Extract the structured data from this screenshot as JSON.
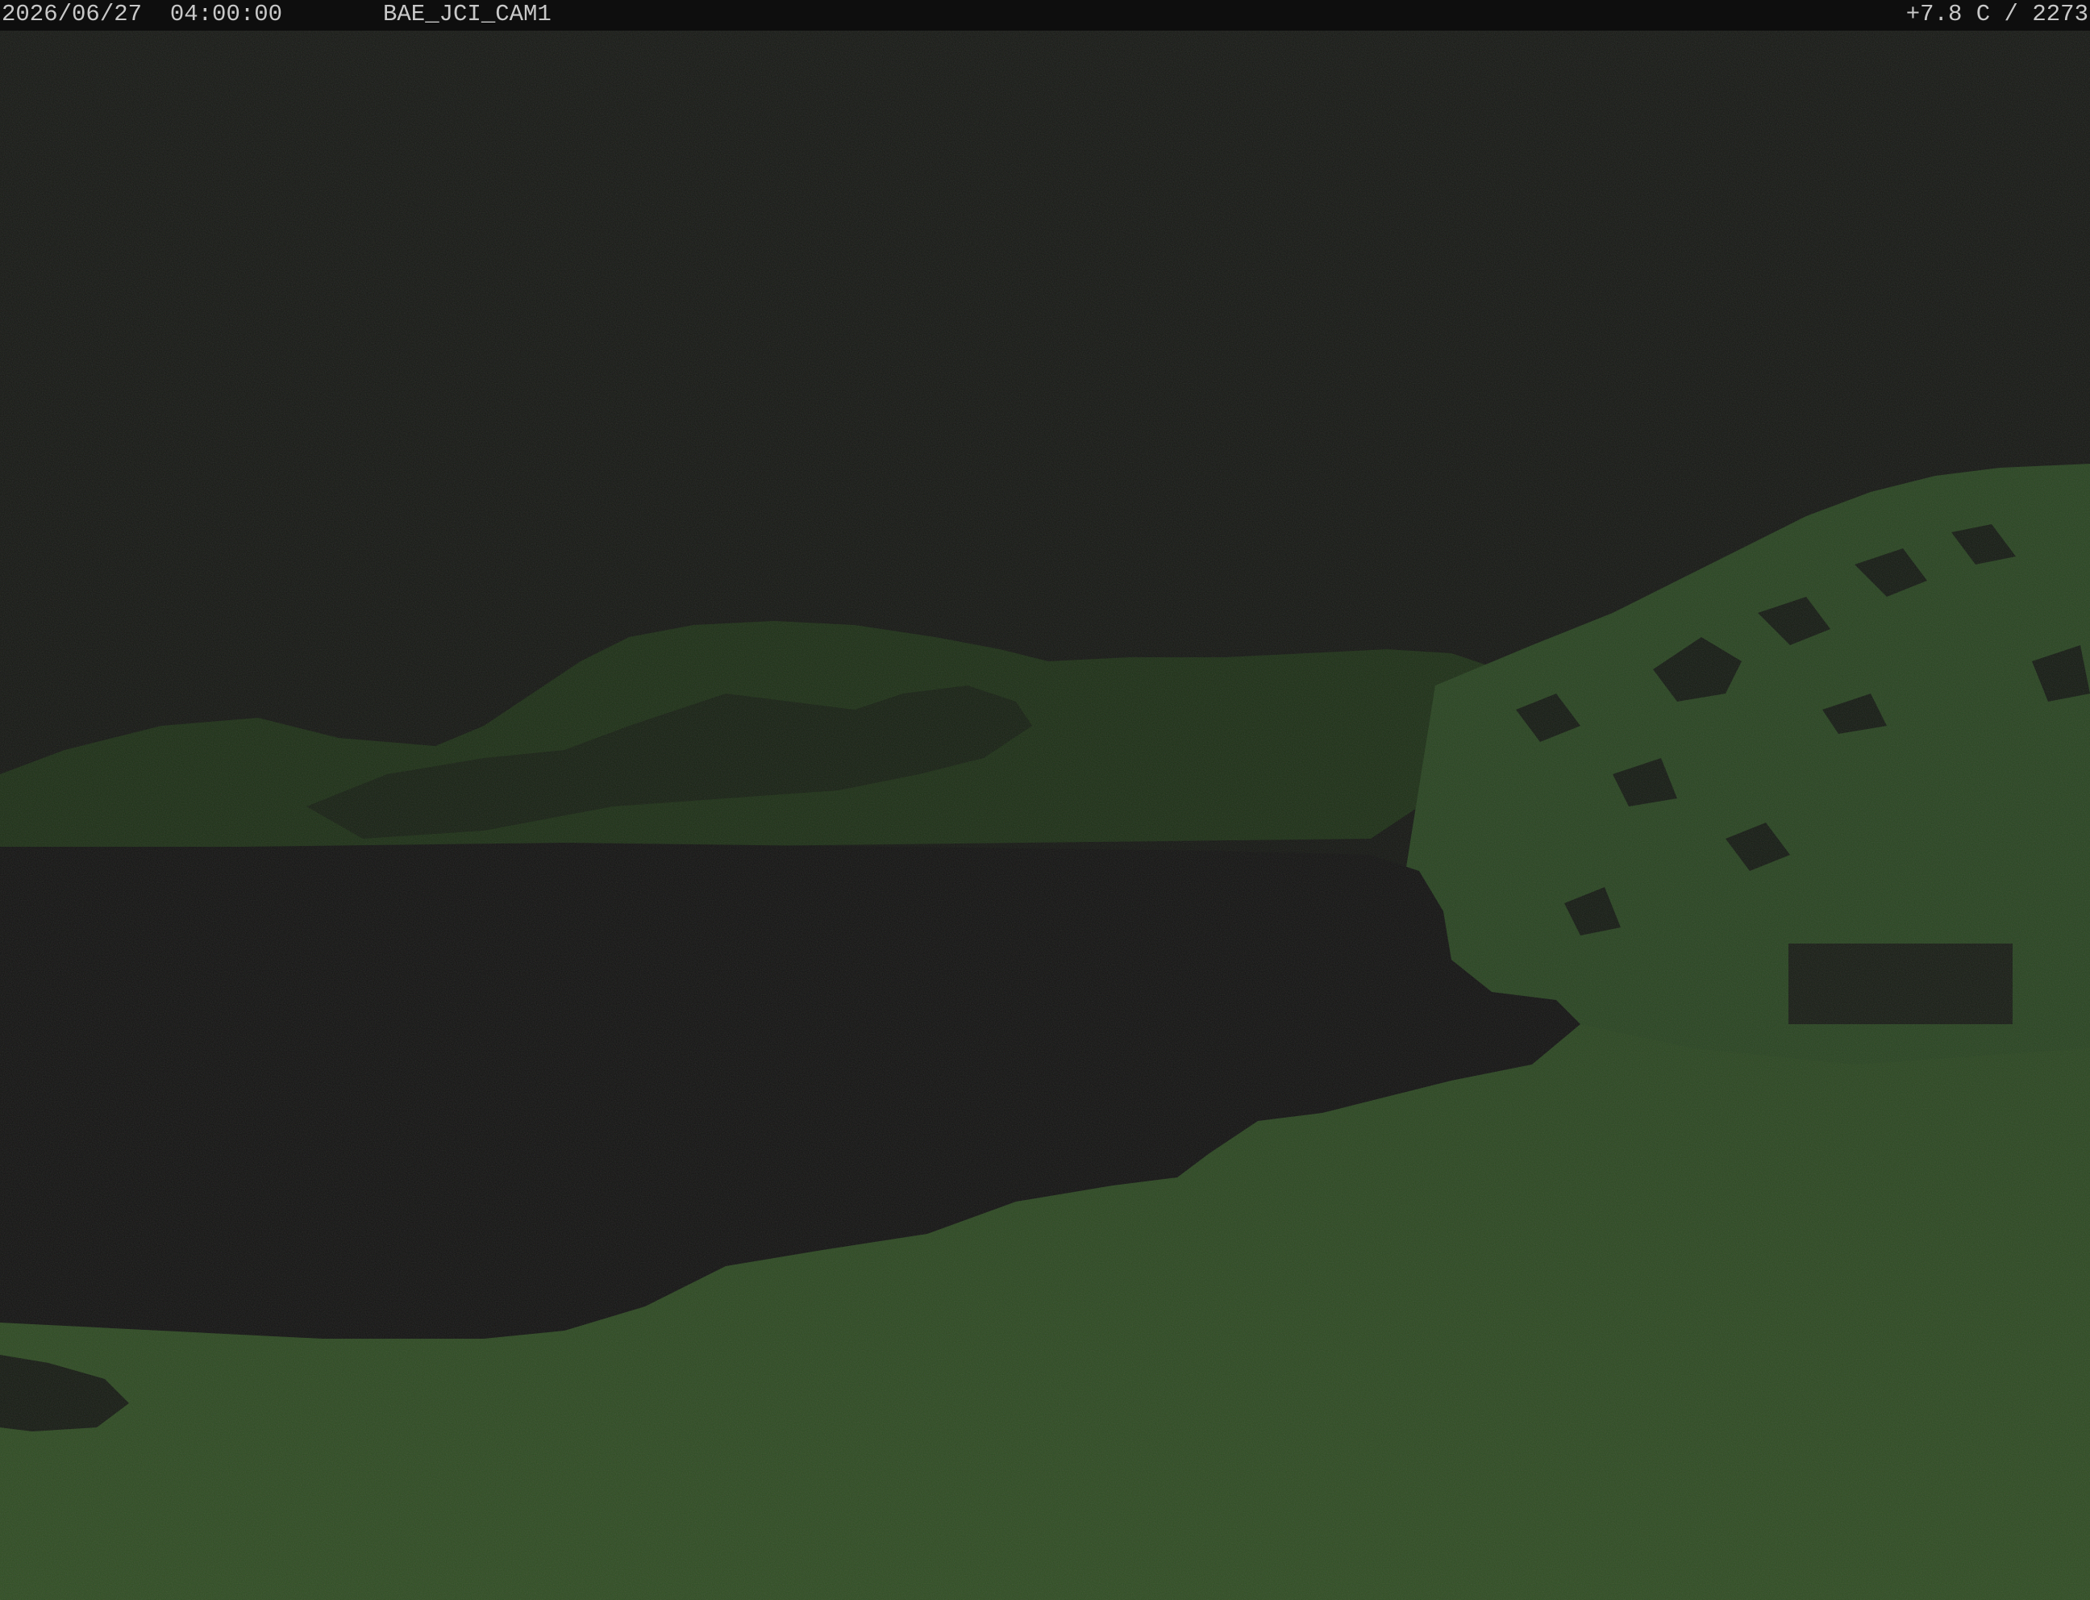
{
  "osd": {
    "date": "2026/06/27",
    "time": "04:00:00",
    "camera_id": "BAE_JCI_CAM1",
    "temperature": "+7.8 C",
    "altitude": "2273"
  },
  "scene": {
    "description_colors": {
      "sky": "#141612",
      "lake": "#111110",
      "grass": "#2c4a1e",
      "hill": "#233a18",
      "rock": "#141712"
    }
  }
}
